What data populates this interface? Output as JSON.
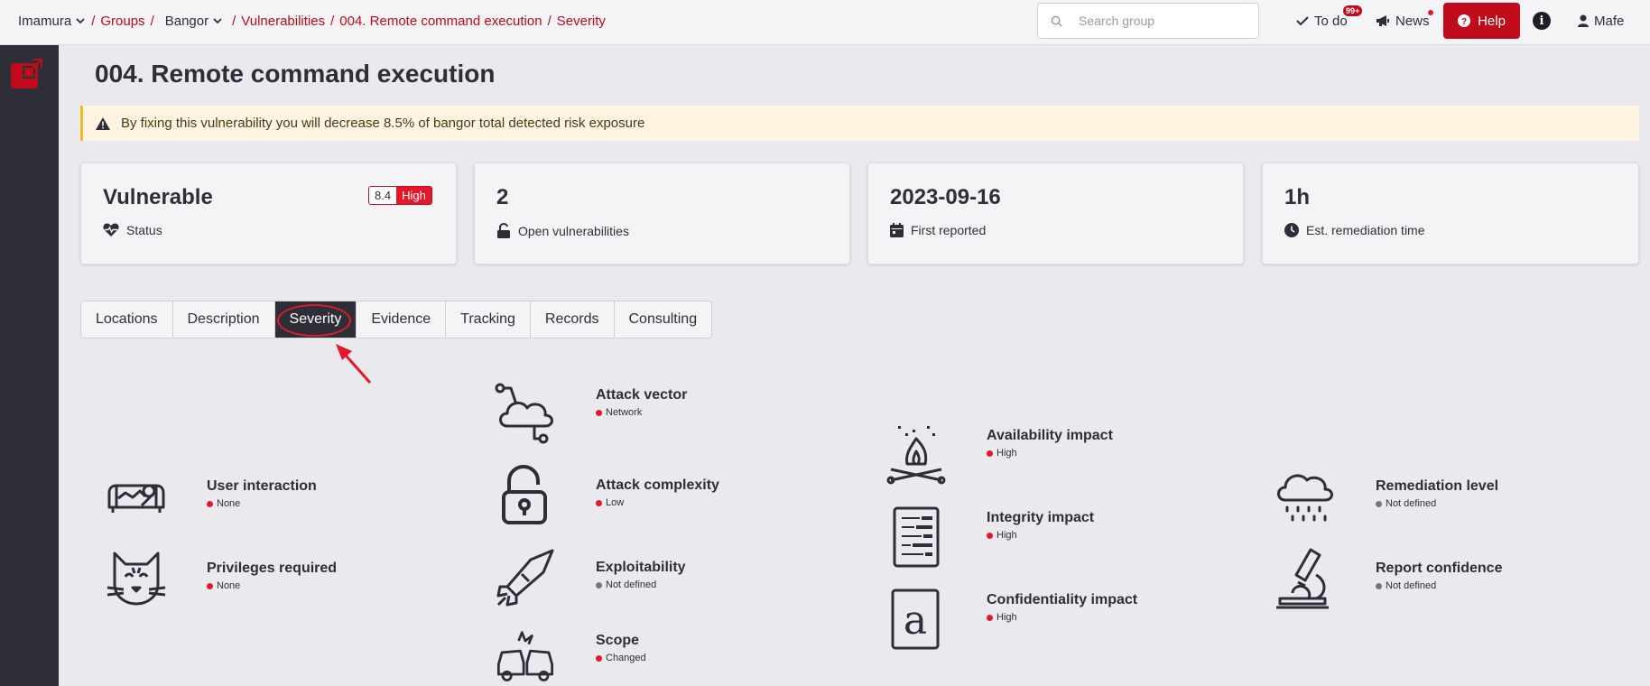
{
  "breadcrumb": {
    "org": "Imamura",
    "groups": "Groups",
    "group": "Bangor",
    "vulnerabilities": "Vulnerabilities",
    "finding": "004. Remote command execution",
    "section": "Severity",
    "sep": "/"
  },
  "search": {
    "placeholder": "Search group"
  },
  "nav": {
    "todo": "To do",
    "todo_badge": "99+",
    "news": "News",
    "help": "Help",
    "user": "Mafe"
  },
  "page": {
    "title": "004. Remote command execution",
    "alert": "By fixing this vulnerability you will decrease 8.5% of bangor total detected risk exposure"
  },
  "cards": {
    "status": {
      "value": "Vulnerable",
      "label": "Status",
      "score": "8.4",
      "level": "High"
    },
    "open": {
      "value": "2",
      "label": "Open vulnerabilities"
    },
    "reported": {
      "value": "2023-09-16",
      "label": "First reported"
    },
    "remediation": {
      "value": "1h",
      "label": "Est. remediation time"
    }
  },
  "tabs": [
    "Locations",
    "Description",
    "Severity",
    "Evidence",
    "Tracking",
    "Records",
    "Consulting"
  ],
  "active_tab": "Severity",
  "metrics": {
    "user_interaction": {
      "name": "User interaction",
      "value": "None",
      "status": "red"
    },
    "privileges_required": {
      "name": "Privileges required",
      "value": "None",
      "status": "red"
    },
    "attack_vector": {
      "name": "Attack vector",
      "value": "Network",
      "status": "red"
    },
    "attack_complexity": {
      "name": "Attack complexity",
      "value": "Low",
      "status": "red"
    },
    "exploitability": {
      "name": "Exploitability",
      "value": "Not defined",
      "status": "gray"
    },
    "scope": {
      "name": "Scope",
      "value": "Changed",
      "status": "red"
    },
    "availability_impact": {
      "name": "Availability impact",
      "value": "High",
      "status": "red"
    },
    "integrity_impact": {
      "name": "Integrity impact",
      "value": "High",
      "status": "red"
    },
    "confidentiality_impact": {
      "name": "Confidentiality impact",
      "value": "High",
      "status": "red"
    },
    "remediation_level": {
      "name": "Remediation level",
      "value": "Not defined",
      "status": "gray"
    },
    "report_confidence": {
      "name": "Report confidence",
      "value": "Not defined",
      "status": "gray"
    }
  },
  "colors": {
    "brand": "#bf0b1a",
    "dot_red": "#e3192b",
    "dot_gray": "#777780",
    "sidebar": "#2e2e38",
    "alert_bg": "#fff4e1"
  }
}
